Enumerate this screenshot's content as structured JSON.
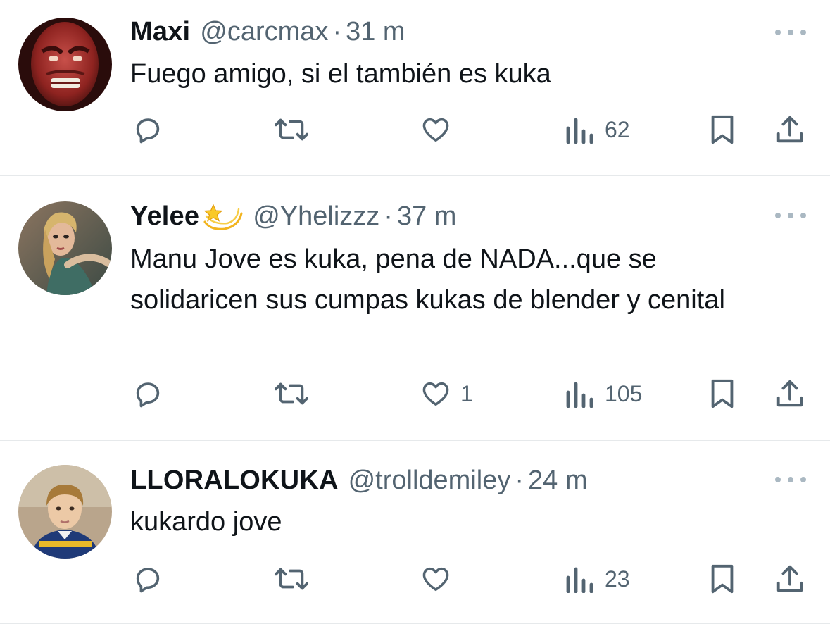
{
  "tweets": [
    {
      "name": "Maxi",
      "handle": "@carcmax",
      "dot": "·",
      "time": "31 m",
      "text": "Fuego amigo, si el también es kuka",
      "likes": "",
      "views": "62",
      "avatar": "hulk-avatar"
    },
    {
      "name": "Yelee",
      "handle": "@Yhelizzz",
      "dot": "·",
      "time": "37 m",
      "text": "Manu Jove es kuka, pena de NADA...que se solidaricen sus cumpas kukas de blender y cenital",
      "likes": "1",
      "views": "105",
      "avatar": "woman-avatar"
    },
    {
      "name": "LLORALOKUKA",
      "handle": "@trolldemiley",
      "dot": "·",
      "time": "24 m",
      "text": "kukardo jove",
      "likes": "",
      "views": "23",
      "avatar": "boy-avatar"
    }
  ],
  "icons": {
    "reply": "speech-bubble",
    "retweet": "repost-arrows",
    "like": "heart",
    "views": "bar-chart",
    "bookmark": "bookmark",
    "share": "upload-arrow",
    "more": "three-dots",
    "emoji": "dizzy-star"
  },
  "colors": {
    "text": "#0f1419",
    "secondary": "#536471",
    "divider": "#e6e9eb"
  }
}
